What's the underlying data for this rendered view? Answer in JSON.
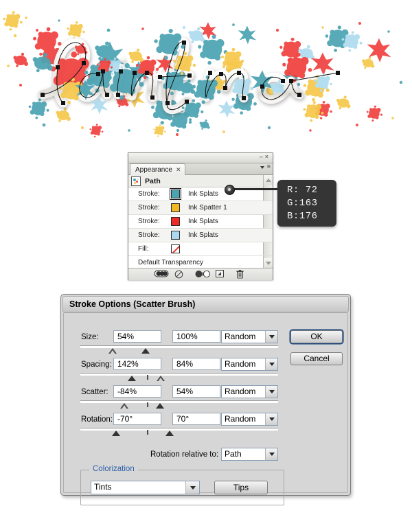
{
  "artwork": {
    "name": "paint-splatter-lettering",
    "word": "Paint me",
    "palette": {
      "teal": "#4CA3B2",
      "red": "#F0413E",
      "yellow": "#F6C84C",
      "light_blue": "#AEDCEF",
      "path_stroke": "#111111"
    }
  },
  "appearance_panel": {
    "window_buttons": {
      "minimize": "–",
      "close": "×"
    },
    "tab": {
      "label": "Appearance",
      "close": "✕"
    },
    "item_header": "Path",
    "rows": [
      {
        "label": "Stroke:",
        "swatch": "#4CA3B2",
        "name": "Ink Splats",
        "selected": true
      },
      {
        "label": "Stroke:",
        "swatch": "#F2B824",
        "name": "Ink Spatter 1",
        "selected": false
      },
      {
        "label": "Stroke:",
        "swatch": "#ED2B26",
        "name": "Ink Splats",
        "selected": false
      },
      {
        "label": "Stroke:",
        "swatch": "#ABD8EE",
        "name": "Ink Splats",
        "selected": false
      },
      {
        "label": "Fill:",
        "swatch": "none",
        "name": "",
        "selected": false
      }
    ],
    "footer_item": "Default Transparency",
    "footer_icons": [
      "toggle-visibility-icon",
      "clear-appearance-icon",
      "reduce-to-basic-appearance-icon",
      "duplicate-item-icon",
      "delete-item-icon"
    ]
  },
  "color_tooltip": {
    "r_line": "R: 72",
    "g_line": "G:163",
    "b_line": "B:176",
    "r": 72,
    "g": 163,
    "b": 176,
    "hex": "#48A3B0"
  },
  "dialog": {
    "title": "Stroke Options (Scatter Brush)",
    "rows": [
      {
        "label": "Size:",
        "min": "54%",
        "max": "100%",
        "mode": "Random"
      },
      {
        "label": "Spacing:",
        "min": "142%",
        "max": "84%",
        "mode": "Random"
      },
      {
        "label": "Scatter:",
        "min": "-84%",
        "max": "54%",
        "mode": "Random"
      },
      {
        "label": "Rotation:",
        "min": "-70°",
        "max": "70°",
        "mode": "Random"
      }
    ],
    "rotation_relative_label": "Rotation relative to:",
    "rotation_relative_value": "Path",
    "colorization_legend": "Colorization",
    "colorization_value": "Tints",
    "tips_button": "Tips",
    "ok_button": "OK",
    "cancel_button": "Cancel"
  }
}
